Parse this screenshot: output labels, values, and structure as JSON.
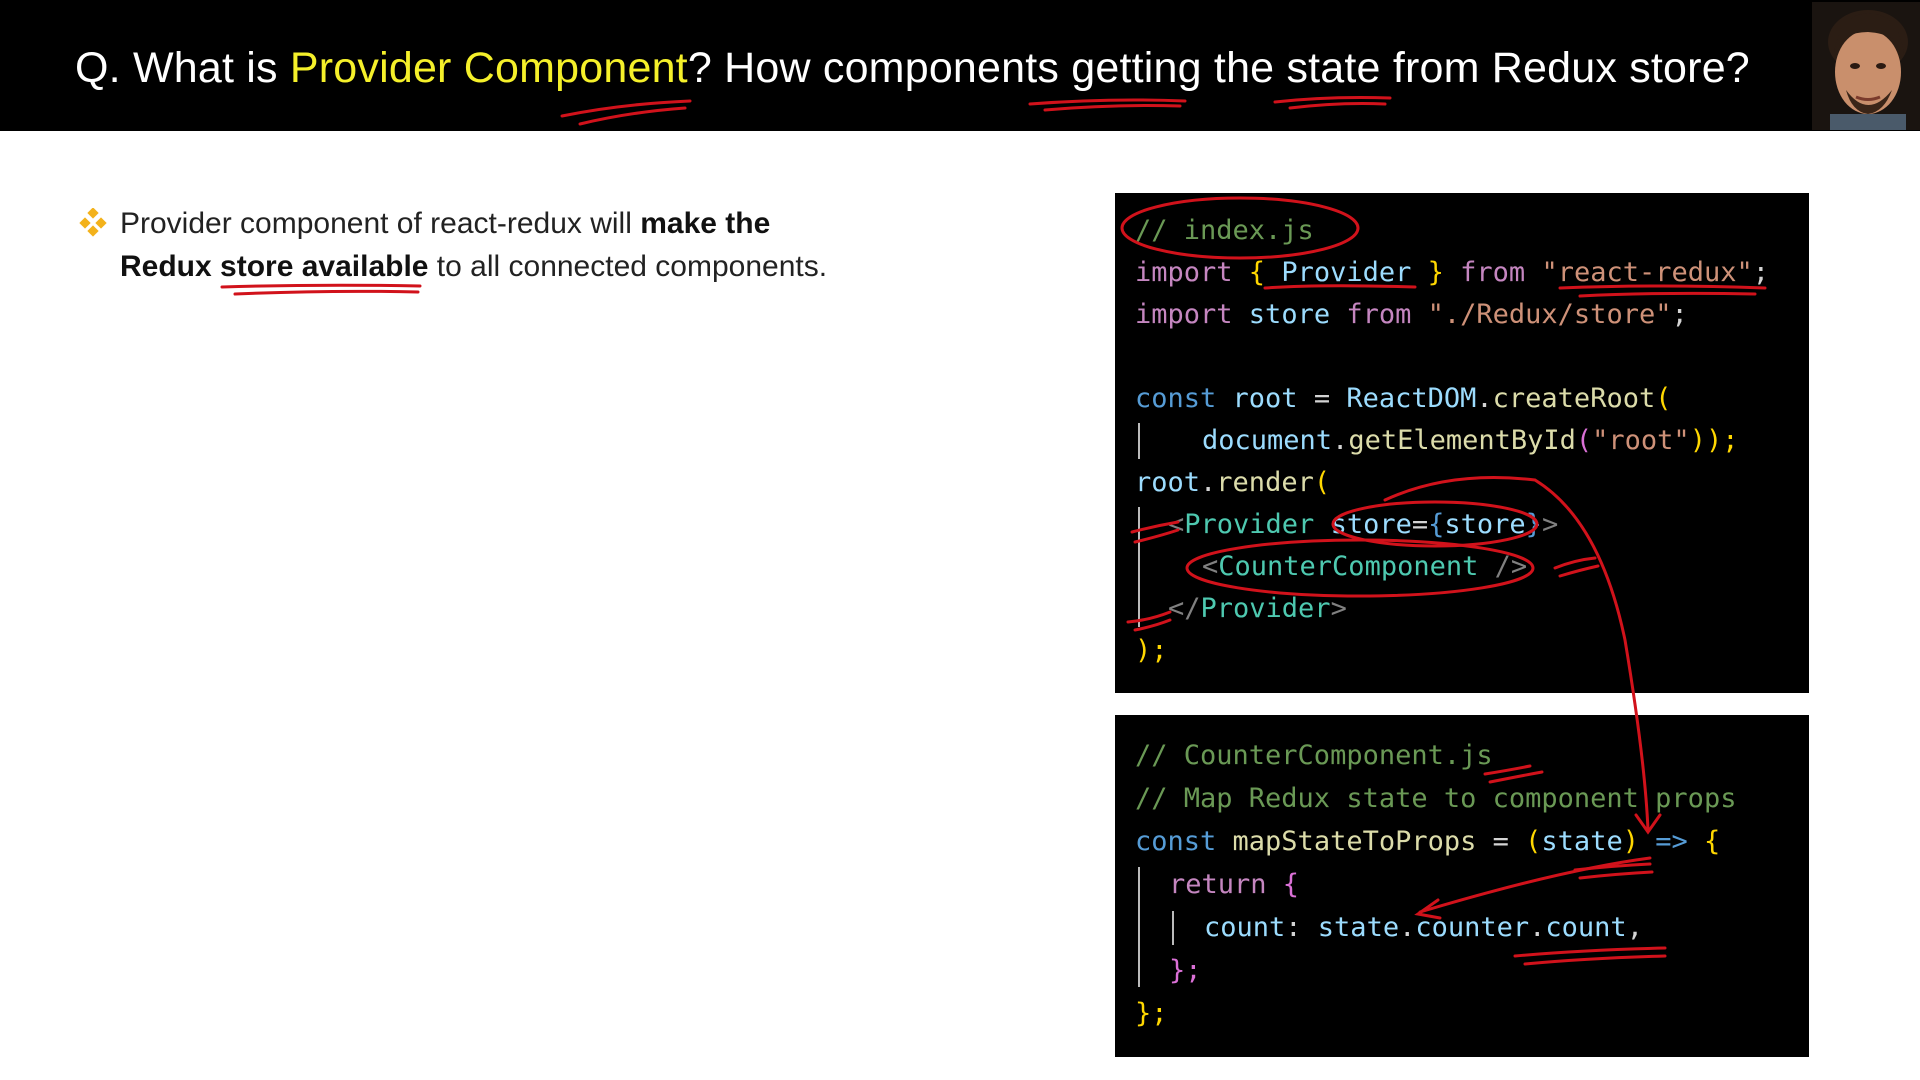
{
  "title": {
    "prefix": "Q. What is ",
    "highlight": "Provider Component",
    "suffix": "? How components getting the state from Redux store?"
  },
  "bullet": {
    "part1": "Provider component of react-redux will ",
    "bold1": "make the",
    "bold2": "Redux store available",
    "part2": " to all connected components."
  },
  "code_index": {
    "l1": "// index.js",
    "l2_import": "import",
    "l2_open": " { ",
    "l2_provider": "Provider",
    "l2_close": " } ",
    "l2_from": "from",
    "l2_str": "\"react-redux\"",
    "l2_semi": ";",
    "l3_import": "import",
    "l3_store": " store ",
    "l3_from": "from",
    "l3_str": " \"./Redux/store\"",
    "l3_semi": ";",
    "l5_const": "const",
    "l5_root": " root ",
    "l5_eq": "= ",
    "l5_reactdom": "ReactDOM",
    "l5_dot": ".",
    "l5_fn": "createRoot",
    "l5_paren": "(",
    "l6_doc": "document",
    "l6_dot": ".",
    "l6_fn": "getElementById",
    "l6_p1": "(",
    "l6_str": "\"root\"",
    "l6_p2": "));",
    "l7_root": "root",
    "l7_dot": ".",
    "l7_fn": "render",
    "l7_paren": "(",
    "l8_lt": "<",
    "l8_tag": "Provider",
    "l8_attr": " store",
    "l8_eq": "=",
    "l8_br1": "{",
    "l8_val": "store",
    "l8_br2": "}",
    "l8_gt": ">",
    "l9_lt": "<",
    "l9_tag": "CounterComponent",
    "l9_end": " />",
    "l10_lt": "</",
    "l10_tag": "Provider",
    "l10_gt": ">",
    "l11": ");"
  },
  "code_counter": {
    "l1": "// CounterComponent.js",
    "l2": "// Map Redux state to component props",
    "l3_const": "const",
    "l3_name": " mapStateToProps",
    "l3_eq": " = ",
    "l3_p1": "(",
    "l3_state": "state",
    "l3_p2": ")",
    "l3_arrow": " => ",
    "l3_br": "{",
    "l4_return": "return",
    "l4_br": " {",
    "l5_count": "count",
    "l5_colon": ": ",
    "l5_state": "state",
    "l5_dot1": ".",
    "l5_counter": "counter",
    "l5_dot2": ".",
    "l5_count2": "count",
    "l5_comma": ",",
    "l6": "};",
    "l7": "};"
  },
  "colors": {
    "title_highlight": "#f5f02a",
    "annotation_ink": "#d1121b",
    "code_bg": "#000000"
  },
  "icons": [
    "bullet-diamond-icon",
    "presenter-avatar"
  ]
}
